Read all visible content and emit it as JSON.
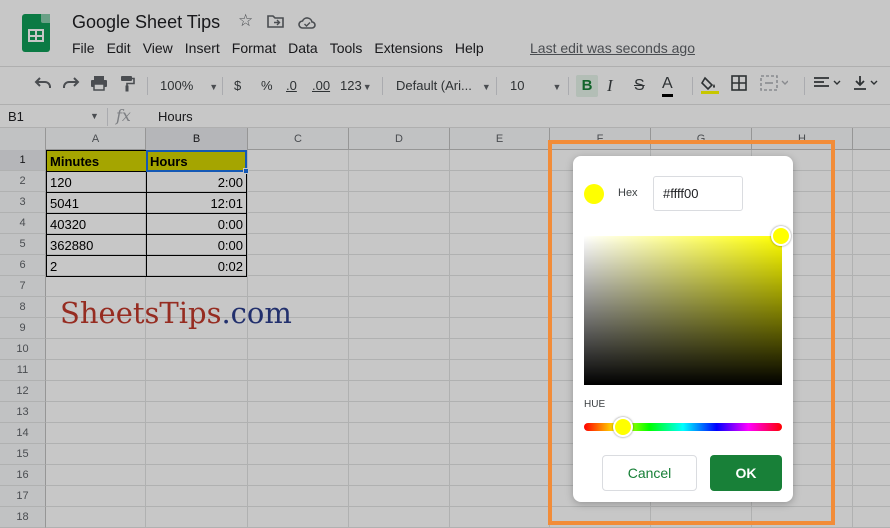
{
  "header": {
    "title": "Google Sheet Tips",
    "menu": [
      "File",
      "Edit",
      "View",
      "Insert",
      "Format",
      "Data",
      "Tools",
      "Extensions",
      "Help"
    ],
    "last_edit": "Last edit was seconds ago"
  },
  "toolbar": {
    "zoom": "100%",
    "currency": "$",
    "percent": "%",
    "decrease_decimal": ".0",
    "increase_decimal": ".00",
    "more_formats": "123",
    "font": "Default (Ari...",
    "font_size": "10",
    "bold": "B",
    "italic": "I",
    "strikethrough": "S",
    "text_color": "A"
  },
  "formula_bar": {
    "cell_ref": "B1",
    "fx": "fx",
    "value": "Hours"
  },
  "grid": {
    "columns": [
      "A",
      "B",
      "C",
      "D",
      "E",
      "F",
      "G",
      "H"
    ],
    "rows": [
      "1",
      "2",
      "3",
      "4",
      "5",
      "6",
      "7",
      "8",
      "9",
      "10",
      "11",
      "12",
      "13",
      "14",
      "15",
      "16",
      "17",
      "18"
    ],
    "cells": [
      [
        "Minutes",
        "Hours"
      ],
      [
        "120",
        "2:00"
      ],
      [
        "5041",
        "12:01"
      ],
      [
        "40320",
        "0:00"
      ],
      [
        "362880",
        "0:00"
      ],
      [
        "2",
        "0:02"
      ]
    ]
  },
  "watermark": {
    "part1": "SheetsTips",
    "part2": ".com"
  },
  "color_picker": {
    "hex_label": "Hex",
    "hex_value": "#ffff00",
    "hue_label": "HUE",
    "cancel": "Cancel",
    "ok": "OK",
    "selected_color": "#ffff00"
  },
  "colors": {
    "accent_green": "#188038",
    "header_fill": "#d4d400",
    "highlight_frame": "#f28c38"
  }
}
